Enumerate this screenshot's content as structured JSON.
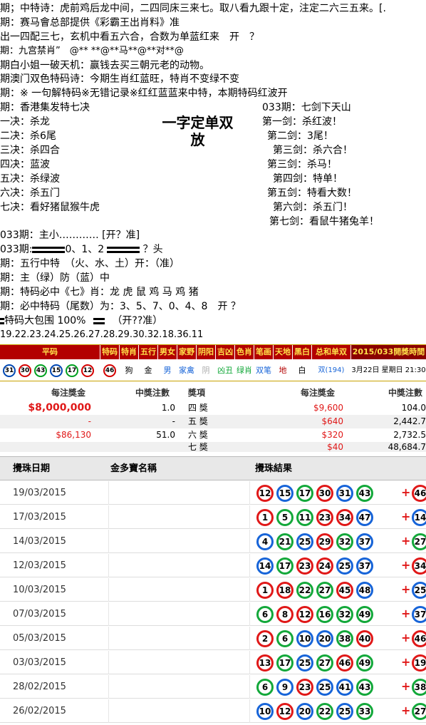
{
  "text_lines": [
    "期；中特诗：虎前鸡后龙中间，二四同床三来七。取八看九跟十定，注定二六三五来。[.",
    "期：赛马會总部提供《彩霸王出肖料》准",
    "出一四配三七，玄机中看五六合，合数为单蓝红来　开　？",
    "期：九宫禁肖”　@** **@**马**@**对**@",
    "期白小姐一破天机：赢钱去买三朝元老的动物。",
    "期澳门双色特码诗：今期生肖红蓝旺，特肖不变绿不变",
    "期：※ 一句解特码※无错记录※红红蓝蓝来中特，本期特码红波开"
  ],
  "left_col": {
    "header": "期：香港集发特七决",
    "items": [
      "一决：杀龙",
      "二决：杀6尾",
      "三决：杀四合",
      "四决：蓝波",
      "五决：杀绿波",
      "六决：杀五门",
      "七决：看好猪鼠猴牛虎"
    ]
  },
  "big_title": [
    "一字定单双",
    "放"
  ],
  "right_col": {
    "header": "033期：七剑下天山",
    "items": [
      "第一剑：杀红波！",
      "第二剑：3尾！",
      "第三剑：杀六合！",
      "第三剑：杀马！",
      "第四剑：特单！",
      "第五剑：特看大数！",
      "第六剑：杀五门！",
      "第七剑：看鼠牛猪兔羊！"
    ]
  },
  "lower_lines": [
    "033期：主小………… [开？准]",
    "033期:",
    "期：五行中特　（火、水、土）开：（准）",
    "期：主（绿）防（蓝）中",
    "期：特码必中《七》肖：龙 虎 鼠 鸡 马 鸡 猪",
    "期：必中特码（尾数）为：3、5、7、0、4、8　开 ？",
    "特码大包围 100%",
    "19.22.23.24.25.26.27.28.29.30.32.18.36.11"
  ],
  "head_mid": "0、1、2",
  "head_tail": "？头",
  "bao_tail": "（开??准）",
  "strip": {
    "headers": [
      "平码",
      "特码",
      "特肖",
      "五行",
      "男女",
      "家野",
      "阴阳",
      "吉凶",
      "色肖",
      "笔画",
      "天地",
      "黑白",
      "总和单双",
      "2015/033開獎時間"
    ],
    "ping_ma": [
      {
        "n": "31",
        "c": "blue"
      },
      {
        "n": "30",
        "c": "red"
      },
      {
        "n": "43",
        "c": "green"
      },
      {
        "n": "15",
        "c": "blue"
      },
      {
        "n": "17",
        "c": "green"
      },
      {
        "n": "12",
        "c": "red"
      }
    ],
    "te_ma": {
      "n": "46",
      "c": "red"
    },
    "values": [
      "狗",
      "金",
      "男",
      "家禽",
      "阴",
      "凶丑",
      "绿肖",
      "双笔",
      "地",
      "白",
      "双(194)",
      "3月22日 星期日 21:30"
    ]
  },
  "prize": {
    "left_header": [
      "每注獎金",
      "中獎注數"
    ],
    "right_header": [
      "獎項",
      "每注獎金",
      "中獎注數"
    ],
    "rows": [
      {
        "lp": "$8,000,000",
        "lc": "1.0",
        "name": "四 獎",
        "rp": "$9,600",
        "rc": "104.0"
      },
      {
        "lp": "-",
        "lc": "-",
        "name": "五 獎",
        "rp": "$640",
        "rc": "2,442.7"
      },
      {
        "lp": "$86,130",
        "lc": "51.0",
        "name": "六 獎",
        "rp": "$320",
        "rc": "2,732.5"
      },
      {
        "lp": "",
        "lc": "",
        "name": "七 獎",
        "rp": "$40",
        "rc": "48,684.7"
      }
    ]
  },
  "history": {
    "headers": [
      "攪珠日期",
      "金多寶名稱",
      "攪珠結果"
    ],
    "rows": [
      {
        "date": "19/03/2015",
        "balls": [
          {
            "n": "12",
            "c": "red"
          },
          {
            "n": "15",
            "c": "blue"
          },
          {
            "n": "17",
            "c": "green"
          },
          {
            "n": "30",
            "c": "red"
          },
          {
            "n": "31",
            "c": "blue"
          },
          {
            "n": "43",
            "c": "green"
          }
        ],
        "extra": {
          "n": "46",
          "c": "red"
        }
      },
      {
        "date": "17/03/2015",
        "balls": [
          {
            "n": "1",
            "c": "red"
          },
          {
            "n": "5",
            "c": "green"
          },
          {
            "n": "11",
            "c": "green"
          },
          {
            "n": "23",
            "c": "red"
          },
          {
            "n": "34",
            "c": "red"
          },
          {
            "n": "47",
            "c": "blue"
          }
        ],
        "extra": {
          "n": "14",
          "c": "blue"
        }
      },
      {
        "date": "14/03/2015",
        "balls": [
          {
            "n": "4",
            "c": "blue"
          },
          {
            "n": "21",
            "c": "green"
          },
          {
            "n": "25",
            "c": "blue"
          },
          {
            "n": "29",
            "c": "red"
          },
          {
            "n": "32",
            "c": "green"
          },
          {
            "n": "37",
            "c": "blue"
          }
        ],
        "extra": {
          "n": "27",
          "c": "green"
        }
      },
      {
        "date": "12/03/2015",
        "balls": [
          {
            "n": "14",
            "c": "blue"
          },
          {
            "n": "17",
            "c": "green"
          },
          {
            "n": "23",
            "c": "red"
          },
          {
            "n": "24",
            "c": "red"
          },
          {
            "n": "25",
            "c": "blue"
          },
          {
            "n": "37",
            "c": "blue"
          }
        ],
        "extra": {
          "n": "34",
          "c": "red"
        }
      },
      {
        "date": "10/03/2015",
        "balls": [
          {
            "n": "1",
            "c": "red"
          },
          {
            "n": "18",
            "c": "red"
          },
          {
            "n": "22",
            "c": "green"
          },
          {
            "n": "27",
            "c": "green"
          },
          {
            "n": "45",
            "c": "red"
          },
          {
            "n": "48",
            "c": "blue"
          }
        ],
        "extra": {
          "n": "25",
          "c": "blue"
        }
      },
      {
        "date": "07/03/2015",
        "balls": [
          {
            "n": "6",
            "c": "green"
          },
          {
            "n": "8",
            "c": "red"
          },
          {
            "n": "12",
            "c": "red"
          },
          {
            "n": "16",
            "c": "green"
          },
          {
            "n": "32",
            "c": "green"
          },
          {
            "n": "49",
            "c": "green"
          }
        ],
        "extra": {
          "n": "37",
          "c": "blue"
        }
      },
      {
        "date": "05/03/2015",
        "balls": [
          {
            "n": "2",
            "c": "red"
          },
          {
            "n": "6",
            "c": "green"
          },
          {
            "n": "10",
            "c": "blue"
          },
          {
            "n": "20",
            "c": "blue"
          },
          {
            "n": "38",
            "c": "green"
          },
          {
            "n": "40",
            "c": "red"
          }
        ],
        "extra": {
          "n": "46",
          "c": "red"
        }
      },
      {
        "date": "03/03/2015",
        "balls": [
          {
            "n": "13",
            "c": "red"
          },
          {
            "n": "17",
            "c": "green"
          },
          {
            "n": "25",
            "c": "blue"
          },
          {
            "n": "27",
            "c": "green"
          },
          {
            "n": "46",
            "c": "red"
          },
          {
            "n": "49",
            "c": "green"
          }
        ],
        "extra": {
          "n": "19",
          "c": "red"
        }
      },
      {
        "date": "28/02/2015",
        "balls": [
          {
            "n": "6",
            "c": "green"
          },
          {
            "n": "9",
            "c": "blue"
          },
          {
            "n": "23",
            "c": "red"
          },
          {
            "n": "25",
            "c": "blue"
          },
          {
            "n": "41",
            "c": "blue"
          },
          {
            "n": "43",
            "c": "green"
          }
        ],
        "extra": {
          "n": "38",
          "c": "green"
        }
      },
      {
        "date": "26/02/2015",
        "balls": [
          {
            "n": "10",
            "c": "blue"
          },
          {
            "n": "12",
            "c": "red"
          },
          {
            "n": "20",
            "c": "blue"
          },
          {
            "n": "22",
            "c": "green"
          },
          {
            "n": "25",
            "c": "blue"
          },
          {
            "n": "33",
            "c": "green"
          }
        ],
        "extra": {
          "n": "27",
          "c": "green"
        }
      }
    ]
  },
  "colors": {
    "red": "#e01818",
    "blue": "#1764d8",
    "green": "#13a83a",
    "strip_header": "#b30000",
    "strip_text": "#ffe14a"
  }
}
